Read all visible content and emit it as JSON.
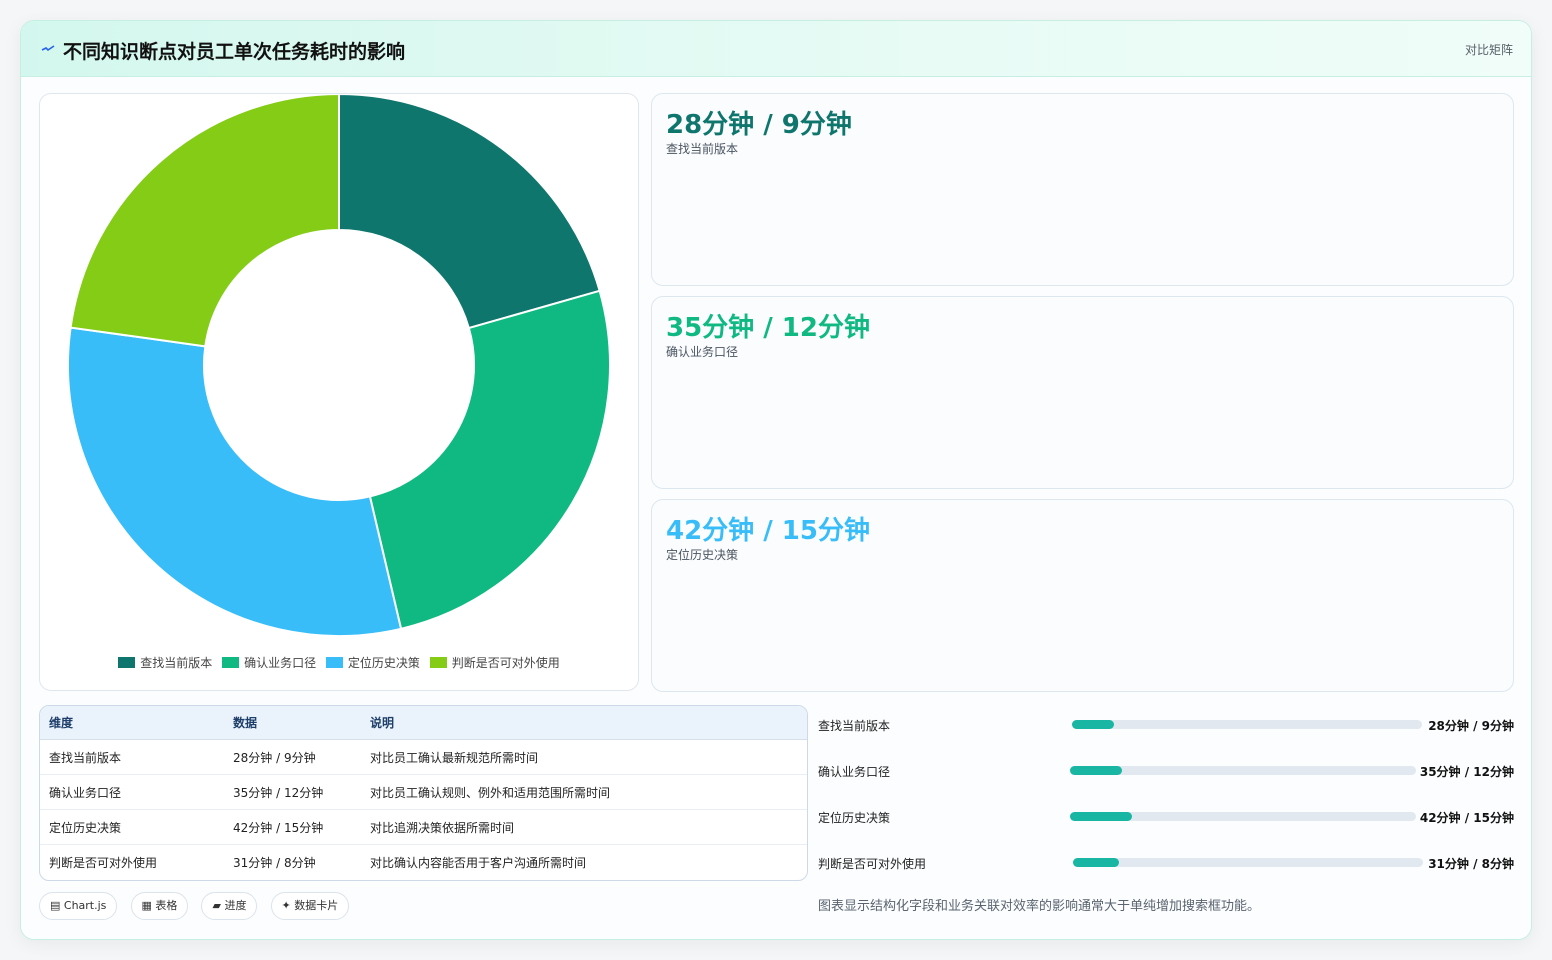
{
  "header": {
    "title": "不同知识断点对员工单次任务耗时的影响",
    "tag": "对比矩阵"
  },
  "colors": {
    "accent": "#19b6a4",
    "series": [
      "#0f766e",
      "#10b981",
      "#38bdf8",
      "#84cc16"
    ]
  },
  "chart_data": {
    "type": "pie",
    "donut": true,
    "categories": [
      "查找当前版本",
      "确认业务口径",
      "定位历史决策",
      "判断是否可对外使用"
    ],
    "values": [
      28,
      35,
      42,
      31
    ],
    "colors": [
      "#0f766e",
      "#10b981",
      "#38bdf8",
      "#84cc16"
    ],
    "legend_position": "bottom"
  },
  "stats": [
    {
      "value": "28分钟 / 9分钟",
      "label": "查找当前版本",
      "color": "#0f766e"
    },
    {
      "value": "35分钟 / 12分钟",
      "label": "确认业务口径",
      "color": "#10b981"
    },
    {
      "value": "42分钟 / 15分钟",
      "label": "定位历史决策",
      "color": "#38bdf8"
    }
  ],
  "table": {
    "headers": [
      "维度",
      "数据",
      "说明"
    ],
    "rows": [
      [
        "查找当前版本",
        "28分钟 / 9分钟",
        "对比员工确认最新规范所需时间"
      ],
      [
        "确认业务口径",
        "35分钟 / 12分钟",
        "对比员工确认规则、例外和适用范围所需时间"
      ],
      [
        "定位历史决策",
        "42分钟 / 15分钟",
        "对比追溯决策依据所需时间"
      ],
      [
        "判断是否可对外使用",
        "31分钟 / 8分钟",
        "对比确认内容能否用于客户沟通所需时间"
      ]
    ]
  },
  "chips": [
    "▤ Chart.js",
    "▦ 表格",
    "▰ 进度",
    "✦ 数据卡片"
  ],
  "progress": [
    {
      "label": "查找当前版本",
      "value": "28分钟 / 9分钟",
      "fraction": 0.12
    },
    {
      "label": "确认业务口径",
      "value": "35分钟 / 12分钟",
      "fraction": 0.15
    },
    {
      "label": "定位历史决策",
      "value": "42分钟 / 15分钟",
      "fraction": 0.18
    },
    {
      "label": "判断是否可对外使用",
      "value": "31分钟 / 8分钟",
      "fraction": 0.13
    }
  ],
  "note": "图表显示结构化字段和业务关联对效率的影响通常大于单纯增加搜索框功能。"
}
